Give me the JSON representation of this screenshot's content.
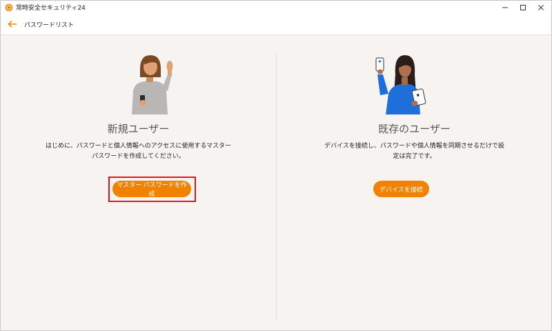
{
  "window": {
    "app_title": "常時安全セキュリティ24"
  },
  "nav": {
    "title": "パスワードリスト"
  },
  "new_user": {
    "heading": "新規ユーザー",
    "desc_line1": "はじめに、パスワードと個人情報へのアクセスに使用するマスター",
    "desc_line2": "パスワードを作成してください。",
    "button_label": "マスター パスワードを作成"
  },
  "existing_user": {
    "heading": "既存のユーザー",
    "desc_line1": "デバイスを接続し、パスワードや個人情報を同期させるだけで設",
    "desc_line2": "定は完了です。",
    "button_label": "デバイスを接続"
  },
  "colors": {
    "accent": "#f08200",
    "highlight": "#e0141f",
    "background": "#f6f3f1"
  }
}
